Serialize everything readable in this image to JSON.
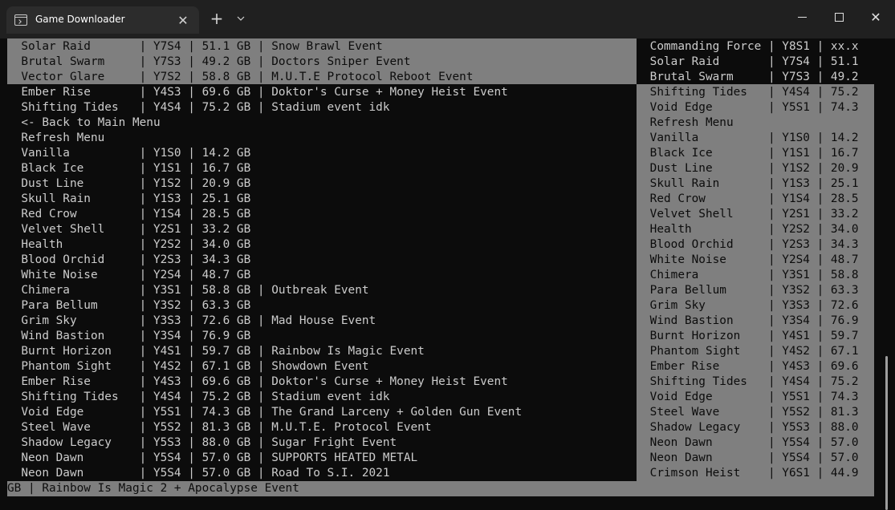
{
  "window": {
    "tab_title": "Game Downloader",
    "tab_icon": "terminal-icon",
    "new_tab_label": "+",
    "dropdown_label": "⌄",
    "close_tab_label": "✕",
    "close_label": "✕"
  },
  "terminal": {
    "background": "#0c0c0c",
    "foreground": "#cccccc",
    "selection_background": "#7f7f7f",
    "selection_foreground": "#0c0c0c"
  },
  "left_rows": [
    {
      "text": "  Solar Raid       | Y7S4 | 51.1 GB | Snow Brawl Event",
      "selected": true
    },
    {
      "text": "  Brutal Swarm     | Y7S3 | 49.2 GB | Doctors Sniper Event",
      "selected": true
    },
    {
      "text": "  Vector Glare     | Y7S2 | 58.8 GB | M.U.T.E Protocol Reboot Event",
      "selected": true
    },
    {
      "text": "  Ember Rise       | Y4S3 | 69.6 GB | Doktor's Curse + Money Heist Event",
      "selected": false
    },
    {
      "text": "  Shifting Tides   | Y4S4 | 75.2 GB | Stadium event idk",
      "selected": false
    },
    {
      "text": "  <- Back to Main Menu",
      "selected": false
    },
    {
      "text": "  Refresh Menu",
      "selected": false
    },
    {
      "text": "  Vanilla          | Y1S0 | 14.2 GB",
      "selected": false
    },
    {
      "text": "  Black Ice        | Y1S1 | 16.7 GB",
      "selected": false
    },
    {
      "text": "  Dust Line        | Y1S2 | 20.9 GB",
      "selected": false
    },
    {
      "text": "  Skull Rain       | Y1S3 | 25.1 GB",
      "selected": false
    },
    {
      "text": "  Red Crow         | Y1S4 | 28.5 GB",
      "selected": false
    },
    {
      "text": "  Velvet Shell     | Y2S1 | 33.2 GB",
      "selected": false
    },
    {
      "text": "  Health           | Y2S2 | 34.0 GB",
      "selected": false
    },
    {
      "text": "  Blood Orchid     | Y2S3 | 34.3 GB",
      "selected": false
    },
    {
      "text": "  White Noise      | Y2S4 | 48.7 GB",
      "selected": false
    },
    {
      "text": "  Chimera          | Y3S1 | 58.8 GB | Outbreak Event",
      "selected": false
    },
    {
      "text": "  Para Bellum      | Y3S2 | 63.3 GB",
      "selected": false
    },
    {
      "text": "  Grim Sky         | Y3S3 | 72.6 GB | Mad House Event",
      "selected": false
    },
    {
      "text": "  Wind Bastion     | Y3S4 | 76.9 GB",
      "selected": false
    },
    {
      "text": "  Burnt Horizon    | Y4S1 | 59.7 GB | Rainbow Is Magic Event",
      "selected": false
    },
    {
      "text": "  Phantom Sight    | Y4S2 | 67.1 GB | Showdown Event",
      "selected": false
    },
    {
      "text": "  Ember Rise       | Y4S3 | 69.6 GB | Doktor's Curse + Money Heist Event",
      "selected": false
    },
    {
      "text": "  Shifting Tides   | Y4S4 | 75.2 GB | Stadium event idk",
      "selected": false
    },
    {
      "text": "  Void Edge        | Y5S1 | 74.3 GB | The Grand Larceny + Golden Gun Event",
      "selected": false
    },
    {
      "text": "  Steel Wave       | Y5S2 | 81.3 GB | M.U.T.E. Protocol Event",
      "selected": false
    },
    {
      "text": "  Shadow Legacy    | Y5S3 | 88.0 GB | Sugar Fright Event",
      "selected": false
    },
    {
      "text": "  Neon Dawn        | Y5S4 | 57.0 GB | SUPPORTS HEATED METAL",
      "selected": false
    },
    {
      "text": "  Neon Dawn        | Y5S4 | 57.0 GB | Road To S.I. 2021",
      "selected": false
    }
  ],
  "right_rows": [
    {
      "text": " Commanding Force | Y8S1 | xx.x",
      "selected": false
    },
    {
      "text": " Solar Raid       | Y7S4 | 51.1",
      "selected": false
    },
    {
      "text": " Brutal Swarm     | Y7S3 | 49.2",
      "selected": false
    },
    {
      "text": " Shifting Tides   | Y4S4 | 75.2",
      "selected": true
    },
    {
      "text": " Void Edge        | Y5S1 | 74.3",
      "selected": true
    },
    {
      "text": " Refresh Menu",
      "selected": true
    },
    {
      "text": " Vanilla          | Y1S0 | 14.2",
      "selected": true
    },
    {
      "text": " Black Ice        | Y1S1 | 16.7",
      "selected": true
    },
    {
      "text": " Dust Line        | Y1S2 | 20.9",
      "selected": true
    },
    {
      "text": " Skull Rain       | Y1S3 | 25.1",
      "selected": true
    },
    {
      "text": " Red Crow         | Y1S4 | 28.5",
      "selected": true
    },
    {
      "text": " Velvet Shell     | Y2S1 | 33.2",
      "selected": true
    },
    {
      "text": " Health           | Y2S2 | 34.0",
      "selected": true
    },
    {
      "text": " Blood Orchid     | Y2S3 | 34.3",
      "selected": true
    },
    {
      "text": " White Noise      | Y2S4 | 48.7",
      "selected": true
    },
    {
      "text": " Chimera          | Y3S1 | 58.8",
      "selected": true
    },
    {
      "text": " Para Bellum      | Y3S2 | 63.3",
      "selected": true
    },
    {
      "text": " Grim Sky         | Y3S3 | 72.6",
      "selected": true
    },
    {
      "text": " Wind Bastion     | Y3S4 | 76.9",
      "selected": true
    },
    {
      "text": " Burnt Horizon    | Y4S1 | 59.7",
      "selected": true
    },
    {
      "text": " Phantom Sight    | Y4S2 | 67.1",
      "selected": true
    },
    {
      "text": " Ember Rise       | Y4S3 | 69.6",
      "selected": true
    },
    {
      "text": " Shifting Tides   | Y4S4 | 75.2",
      "selected": true
    },
    {
      "text": " Void Edge        | Y5S1 | 74.3",
      "selected": true
    },
    {
      "text": " Steel Wave       | Y5S2 | 81.3",
      "selected": true
    },
    {
      "text": " Shadow Legacy    | Y5S3 | 88.0",
      "selected": true
    },
    {
      "text": " Neon Dawn        | Y5S4 | 57.0",
      "selected": true
    },
    {
      "text": " Neon Dawn        | Y5S4 | 57.0",
      "selected": true
    },
    {
      "text": " Crimson Heist    | Y6S1 | 44.9",
      "selected": true
    }
  ],
  "bottom_line": {
    "text": "GB | Rainbow Is Magic 2 + Apocalypse Event",
    "selected": true
  }
}
